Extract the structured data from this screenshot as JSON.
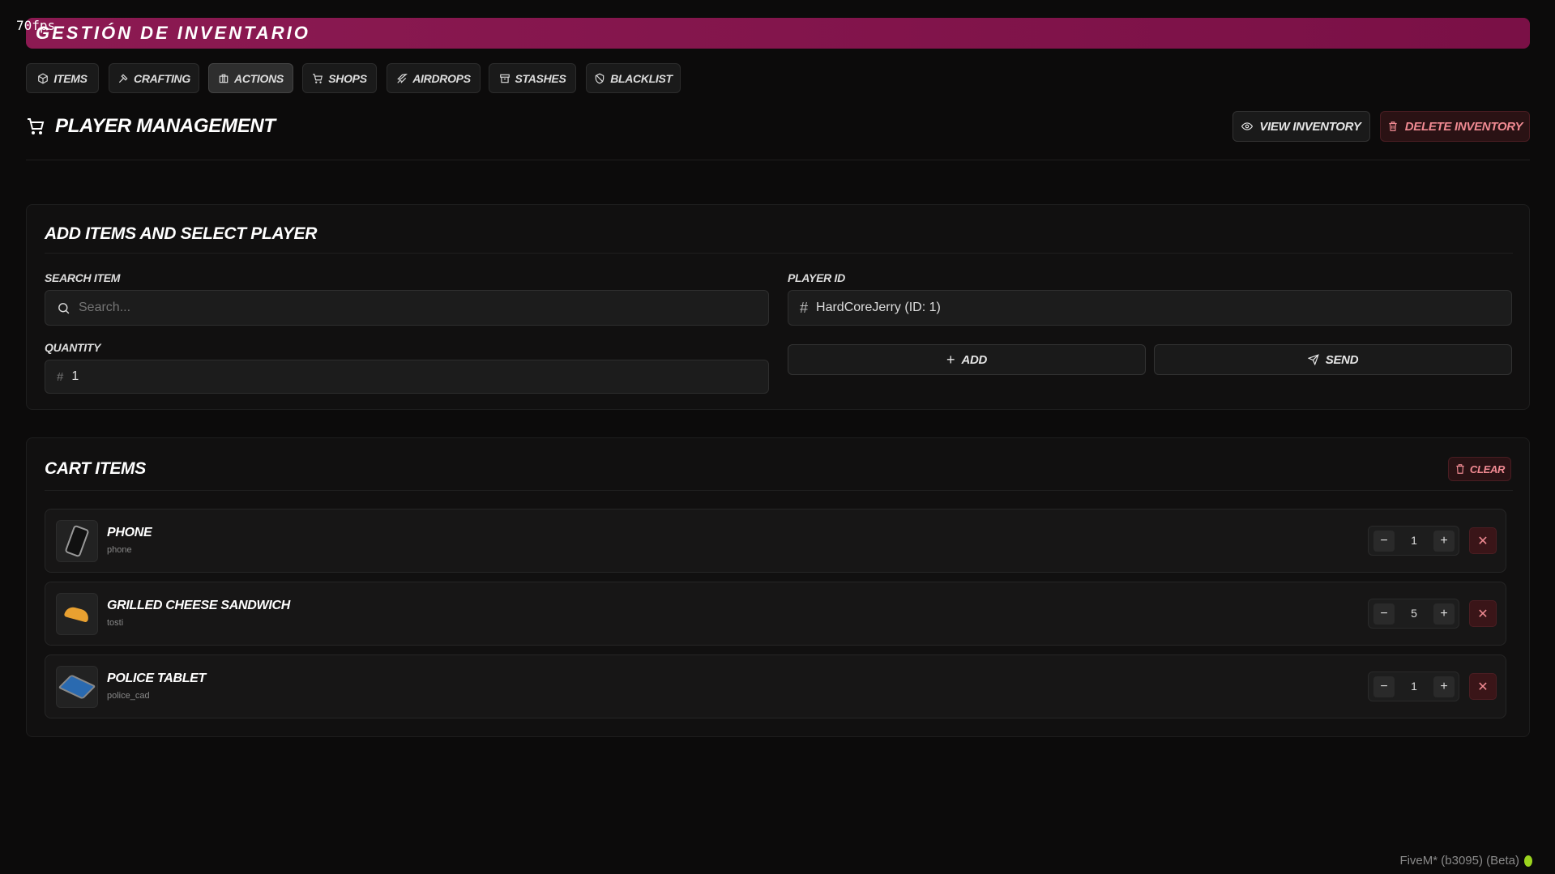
{
  "overlay": {
    "fps": "70fps"
  },
  "header": {
    "title": "Gestión de Inventario"
  },
  "tabs": [
    {
      "label": "Items",
      "icon": "package-icon"
    },
    {
      "label": "Crafting",
      "icon": "hammer-icon"
    },
    {
      "label": "Actions",
      "icon": "briefcase-icon"
    },
    {
      "label": "Shops",
      "icon": "cart-icon"
    },
    {
      "label": "Airdrops",
      "icon": "plane-icon"
    },
    {
      "label": "Stashes",
      "icon": "archive-icon"
    },
    {
      "label": "Blacklist",
      "icon": "shield-off-icon"
    }
  ],
  "section": {
    "title": "Player Management",
    "view_inventory": "View Inventory",
    "delete_inventory": "Delete Inventory"
  },
  "form": {
    "title": "Add Items and Select Player",
    "search_label": "Search Item",
    "search_placeholder": "Search...",
    "player_label": "Player ID",
    "player_value": "HardCoreJerry (ID: 1)",
    "quantity_label": "Quantity",
    "quantity_value": "1",
    "add_label": "Add",
    "send_label": "Send"
  },
  "cart": {
    "title": "Cart Items",
    "clear_label": "Clear",
    "items": [
      {
        "name": "Phone",
        "id": "phone",
        "qty": "1"
      },
      {
        "name": "Grilled Cheese Sandwich",
        "id": "tosti",
        "qty": "5"
      },
      {
        "name": "Police tablet",
        "id": "police_cad",
        "qty": "1"
      }
    ]
  },
  "footer": {
    "text": "FiveM* (b3095) (Beta)"
  },
  "colors": {
    "accent": "#8c1a52",
    "danger": "#f08a92"
  }
}
